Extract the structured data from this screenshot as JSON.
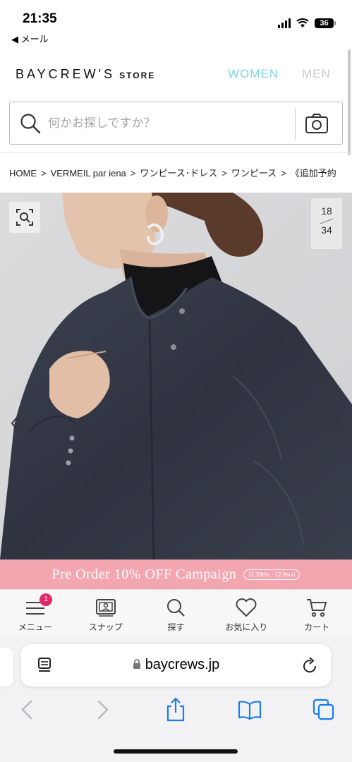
{
  "status_bar": {
    "time": "21:35",
    "back_app": "◀ メール",
    "battery": "36"
  },
  "header": {
    "logo_main": "BAYCREW'S",
    "logo_sub": "STORE",
    "nav_women": "WOMEN",
    "nav_men": "MEN"
  },
  "search": {
    "placeholder": "何かお探しですか？"
  },
  "breadcrumb": [
    "HOME",
    "VERMEIL par iena",
    "ワンピース･ドレス",
    "ワンピース",
    "《追加予約"
  ],
  "breadcrumb_separator": ">",
  "gallery": {
    "current": "18",
    "total": "34"
  },
  "banner": {
    "title": "Pre Order 10% OFF Campaign",
    "dates": "11.28thu - 12.8sun",
    "color": "#f4a6b0"
  },
  "bottom_nav": {
    "items": [
      {
        "label": "メニュー",
        "icon": "menu-icon"
      },
      {
        "label": "スナップ",
        "icon": "snap-icon"
      },
      {
        "label": "探す",
        "icon": "search-icon"
      },
      {
        "label": "お気に入り",
        "icon": "heart-icon"
      },
      {
        "label": "カート",
        "icon": "cart-icon"
      }
    ],
    "menu_badge": "1"
  },
  "browser": {
    "url": "baycrews.jp"
  },
  "colors": {
    "accent_women": "#7fd4ea",
    "badge": "#e3286a",
    "ios_blue": "#1a7cf0"
  }
}
